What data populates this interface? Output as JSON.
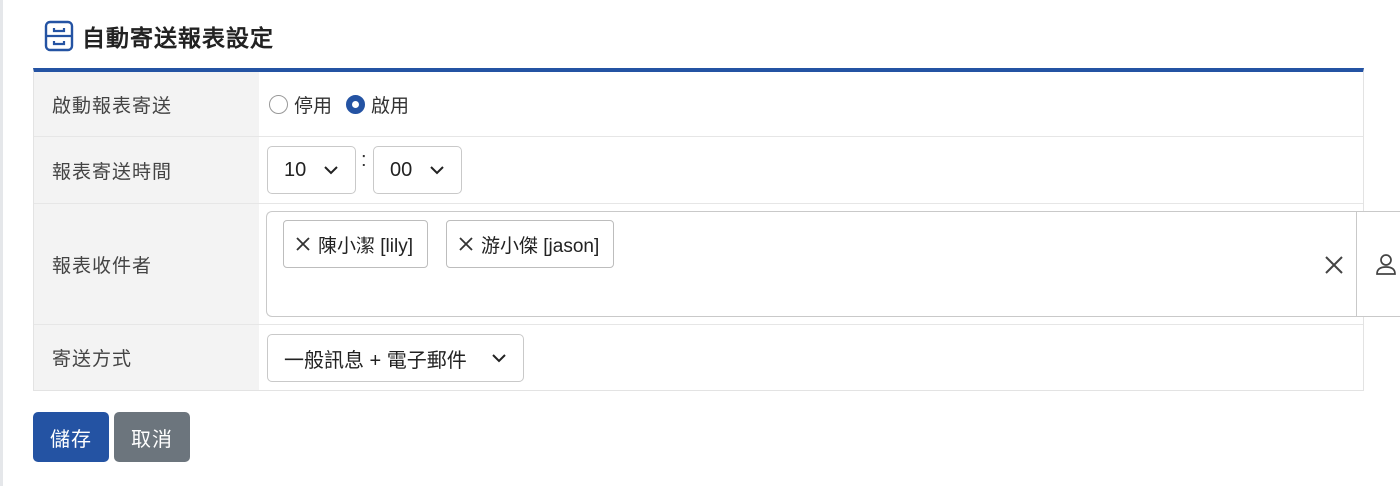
{
  "page": {
    "title": "自動寄送報表設定",
    "icon": "report-folder-icon"
  },
  "form": {
    "enable": {
      "label": "啟動報表寄送",
      "options": [
        {
          "label": "停用",
          "checked": false
        },
        {
          "label": "啟用",
          "checked": true
        }
      ]
    },
    "time": {
      "label": "報表寄送時間",
      "hour": "10",
      "separator": ":",
      "minute": "00"
    },
    "recipients": {
      "label": "報表收件者",
      "tags": [
        "陳小潔 [lily]",
        "游小傑 [jason]"
      ],
      "clear_icon": "close-icon",
      "picker_icon": "user-icon"
    },
    "method": {
      "label": "寄送方式",
      "value": "一般訊息 + 電子郵件"
    }
  },
  "actions": {
    "save_label": "儲存",
    "cancel_label": "取消"
  },
  "colors": {
    "primary": "#2453a3",
    "secondary": "#6c757d",
    "label_bg": "#f3f3f3"
  }
}
